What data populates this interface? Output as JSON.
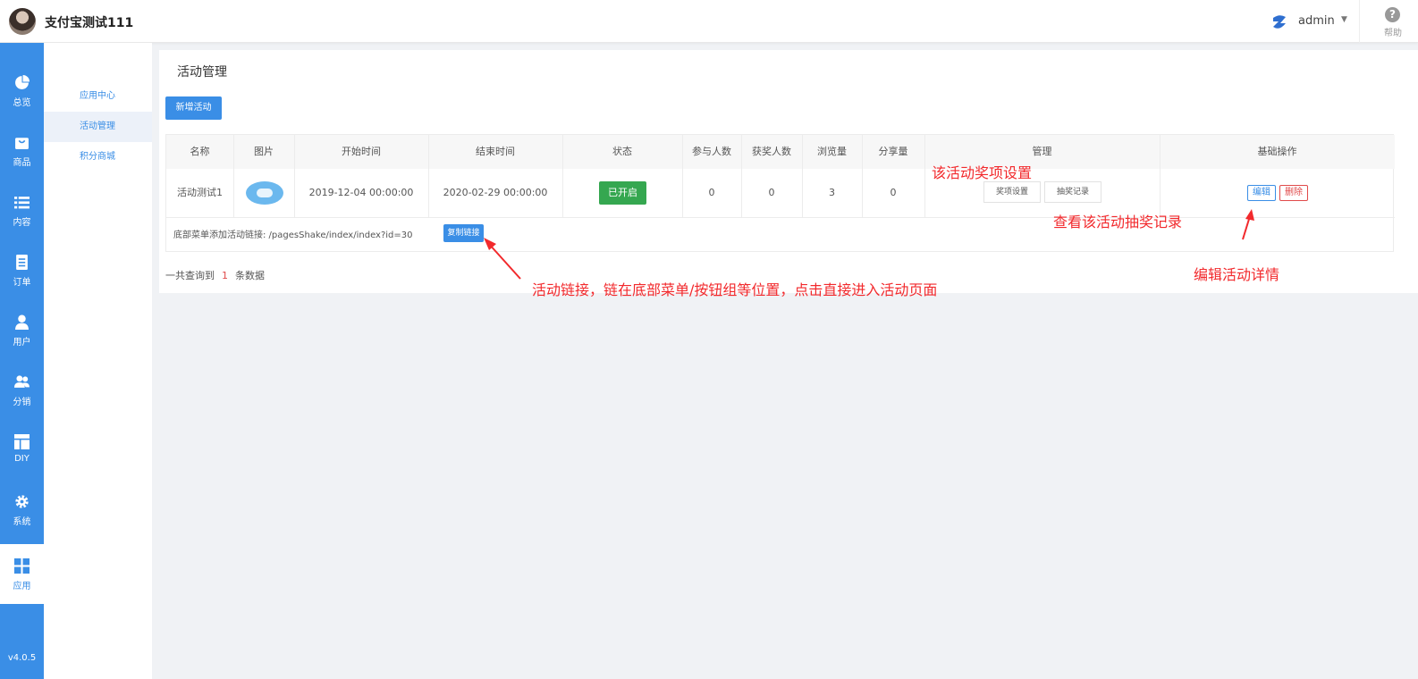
{
  "header": {
    "shop_name": "支付宝测试111",
    "user": "admin",
    "help_label": "帮助"
  },
  "sidebar": {
    "items": [
      {
        "label": "总览",
        "icon": "pie-chart-icon"
      },
      {
        "label": "商品",
        "icon": "shopping-bag-icon"
      },
      {
        "label": "内容",
        "icon": "list-icon"
      },
      {
        "label": "订单",
        "icon": "document-icon"
      },
      {
        "label": "用户",
        "icon": "user-icon"
      },
      {
        "label": "分销",
        "icon": "users-icon"
      },
      {
        "label": "DIY",
        "icon": "layout-icon"
      },
      {
        "label": "系统",
        "icon": "gear-icon"
      },
      {
        "label": "应用",
        "icon": "grid-icon"
      }
    ],
    "version": "v4.0.5"
  },
  "subnav": {
    "items": [
      {
        "label": "应用中心"
      },
      {
        "label": "活动管理"
      },
      {
        "label": "积分商城"
      }
    ]
  },
  "main": {
    "title": "活动管理",
    "add_button": "新增活动",
    "table": {
      "headers": [
        "名称",
        "图片",
        "开始时间",
        "结束时间",
        "状态",
        "参与人数",
        "获奖人数",
        "浏览量",
        "分享量",
        "管理",
        "基础操作"
      ],
      "row": {
        "name": "活动测试1",
        "start": "2019-12-04 00:00:00",
        "end": "2020-02-29 00:00:00",
        "status": "已开启",
        "participants": "0",
        "winners": "0",
        "views": "3",
        "shares": "0",
        "prize_settings": "奖项设置",
        "draw_records": "抽奖记录",
        "edit": "编辑",
        "delete": "删除"
      },
      "link_text": "底部菜单添加活动链接: /pagesShake/index/index?id=30",
      "copy_button": "复制链接"
    },
    "summary": {
      "prefix": "一共查询到",
      "count": "1",
      "suffix": "条数据"
    }
  },
  "annotations": {
    "prize_settings_note": "该活动奖项设置",
    "draw_records_note": "查看该活动抽奖记录",
    "link_note": "活动链接，链在底部菜单/按钮组等位置，点击直接进入活动页面",
    "edit_note": "编辑活动详情"
  },
  "colors": {
    "primary": "#3a8ee6",
    "success": "#35a750",
    "danger": "#e04a4a",
    "annotation": "#f2292c"
  }
}
